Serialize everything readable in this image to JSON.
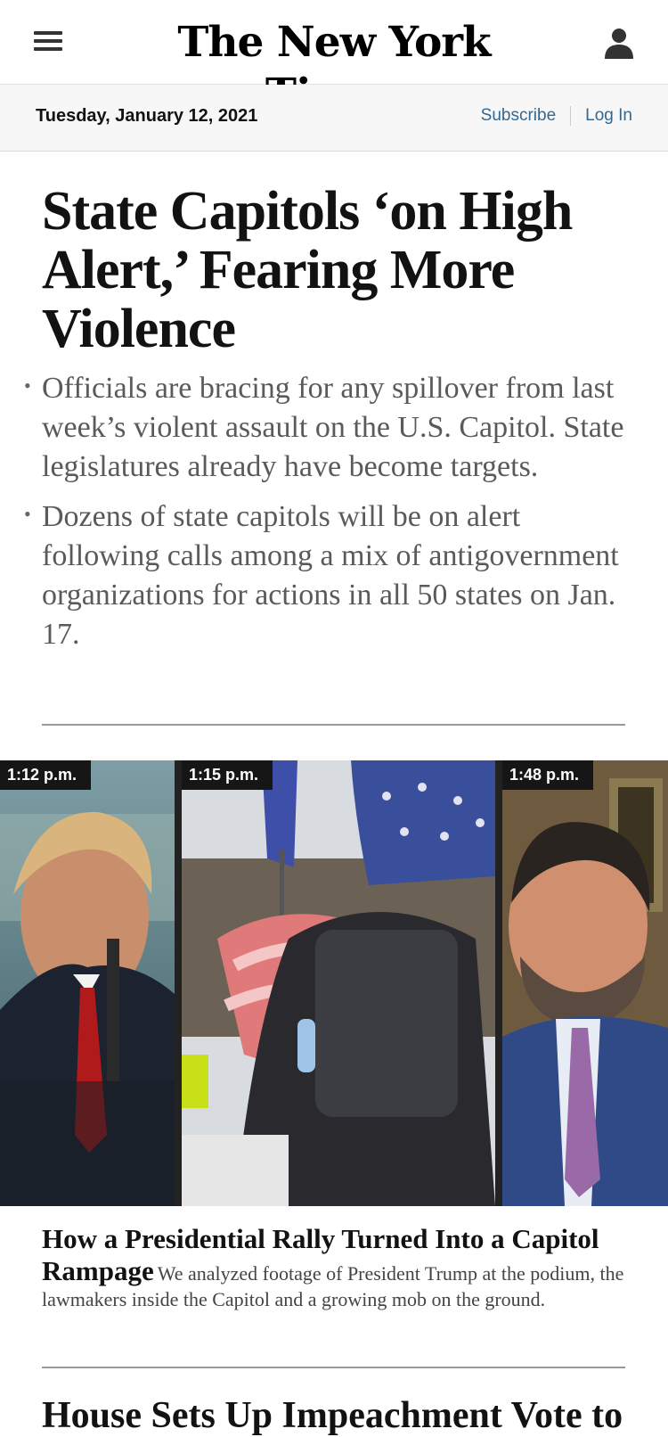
{
  "header": {
    "logo_text": "The New York Times",
    "menu_icon": "hamburger-menu-icon",
    "account_icon": "user-account-icon"
  },
  "datebar": {
    "date": "Tuesday, January 12, 2021",
    "subscribe_label": "Subscribe",
    "login_label": "Log In"
  },
  "lead_story": {
    "headline": "State Capitols ‘on High Alert,’ Fearing More Violence",
    "bullets": [
      "Officials are bracing for any spillover from last week’s violent assault on the U.S. Capitol. State legislatures already have become targets.",
      "Dozens of state capitols will be on alert following calls among a mix of antigovernment organizations for actions in all 50 states on Jan. 17."
    ]
  },
  "video_feature": {
    "panels": [
      {
        "timestamp": "1:12 p.m.",
        "scene": "rally-speaker"
      },
      {
        "timestamp": "1:15 p.m.",
        "scene": "crowd-with-flags"
      },
      {
        "timestamp": "1:48 p.m.",
        "scene": "lawmaker-speaking"
      }
    ],
    "title": "How a Presidential Rally Turned Into a Capitol Rampage",
    "summary": "We analyzed footage of President Trump at the podium, the lawmakers inside the Capitol and a growing mob on the ground."
  },
  "next_story": {
    "headline": "House Sets Up Impeachment Vote to"
  },
  "colors": {
    "link": "#326891",
    "text": "#121212",
    "summary_gray": "#5a5a5a",
    "datebar_bg": "#f7f7f7"
  }
}
